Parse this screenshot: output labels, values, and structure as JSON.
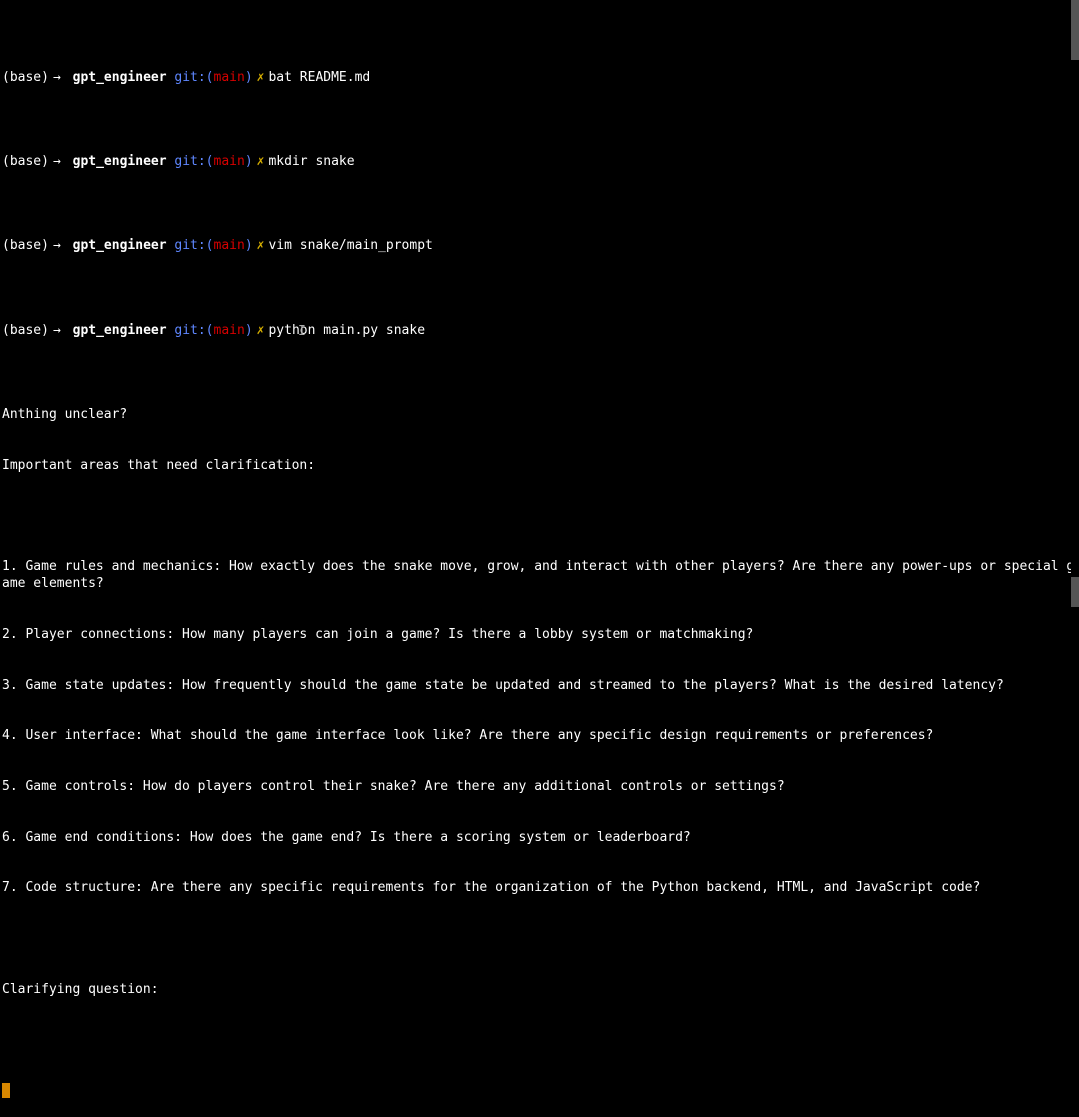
{
  "prompts": [
    {
      "env": "(base)",
      "arrow": "→",
      "dir": "gpt_engineer",
      "git_label": "git:(",
      "git_branch": "main",
      "git_close": ")",
      "dirty": "✗",
      "cmd": "bat README.md"
    },
    {
      "env": "(base)",
      "arrow": "→",
      "dir": "gpt_engineer",
      "git_label": "git:(",
      "git_branch": "main",
      "git_close": ")",
      "dirty": "✗",
      "cmd": "mkdir snake"
    },
    {
      "env": "(base)",
      "arrow": "→",
      "dir": "gpt_engineer",
      "git_label": "git:(",
      "git_branch": "main",
      "git_close": ")",
      "dirty": "✗",
      "cmd": "vim snake/main_prompt"
    },
    {
      "env": "(base)",
      "arrow": "→",
      "dir": "gpt_engineer",
      "git_label": "git:(",
      "git_branch": "main",
      "git_close": ")",
      "dirty": "✗",
      "cmd": "python main.py snake"
    }
  ],
  "output": {
    "l1": "Anthing unclear?",
    "l2": "Important areas that need clarification:",
    "l3": "1. Game rules and mechanics: How exactly does the snake move, grow, and interact with other players? Are there any power-ups or special game elements?",
    "l4": "2. Player connections: How many players can join a game? Is there a lobby system or matchmaking?",
    "l5": "3. Game state updates: How frequently should the game state be updated and streamed to the players? What is the desired latency?",
    "l6": "4. User interface: What should the game interface look like? Are there any specific design requirements or preferences?",
    "l7": "5. Game controls: How do players control their snake? Are there any additional controls or settings?",
    "l8": "6. Game end conditions: How does the game end? Is there a scoring system or leaderboard?",
    "l9": "7. Code structure: Are there any specific requirements for the organization of the Python backend, HTML, and JavaScript code?",
    "l10": "Clarifying question:"
  },
  "ibeam": "I"
}
